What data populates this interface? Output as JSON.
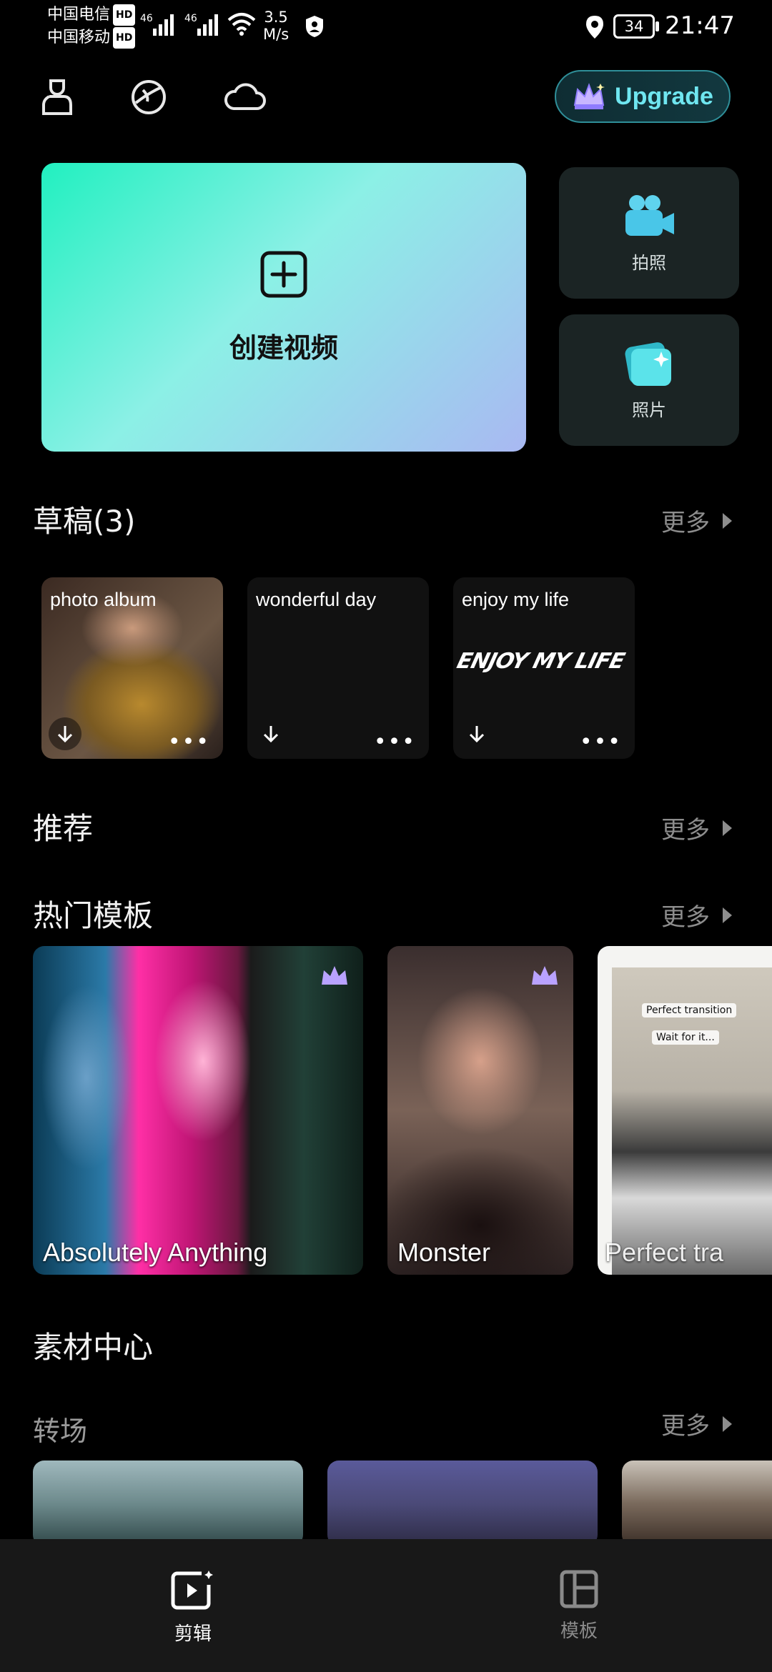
{
  "status_bar": {
    "carrier1": "中国电信",
    "carrier2": "中国移动",
    "hd": "HD",
    "net1": "46",
    "net2": "46",
    "speed_value": "3.5",
    "speed_unit": "M/s",
    "battery": "34",
    "time": "21:47"
  },
  "top_bar": {
    "upgrade_label": "Upgrade"
  },
  "hero": {
    "create_label": "创建视频",
    "camera_label": "拍照",
    "photo_label": "照片"
  },
  "drafts": {
    "title": "草稿(3)",
    "more": "更多",
    "items": [
      {
        "name": "photo album"
      },
      {
        "name": "wonderful day"
      },
      {
        "name": "enjoy my life",
        "art_text": "ENJOY MY LIFE"
      }
    ]
  },
  "recommend": {
    "title": "推荐",
    "more": "更多"
  },
  "hot_templates": {
    "title": "热门模板",
    "more": "更多",
    "items": [
      {
        "name": "Absolutely Anything"
      },
      {
        "name": "Monster"
      },
      {
        "name": "Perfect tra",
        "overlay1": "Perfect transition",
        "overlay2": "Wait for it..."
      }
    ]
  },
  "materials": {
    "title": "素材中心",
    "sub_title": "转场",
    "more": "更多"
  },
  "bottom_nav": {
    "edit_label": "剪辑",
    "template_label": "模板"
  },
  "colors": {
    "accent": "#21f0c0",
    "upgrade_text": "#6fe6f0"
  }
}
